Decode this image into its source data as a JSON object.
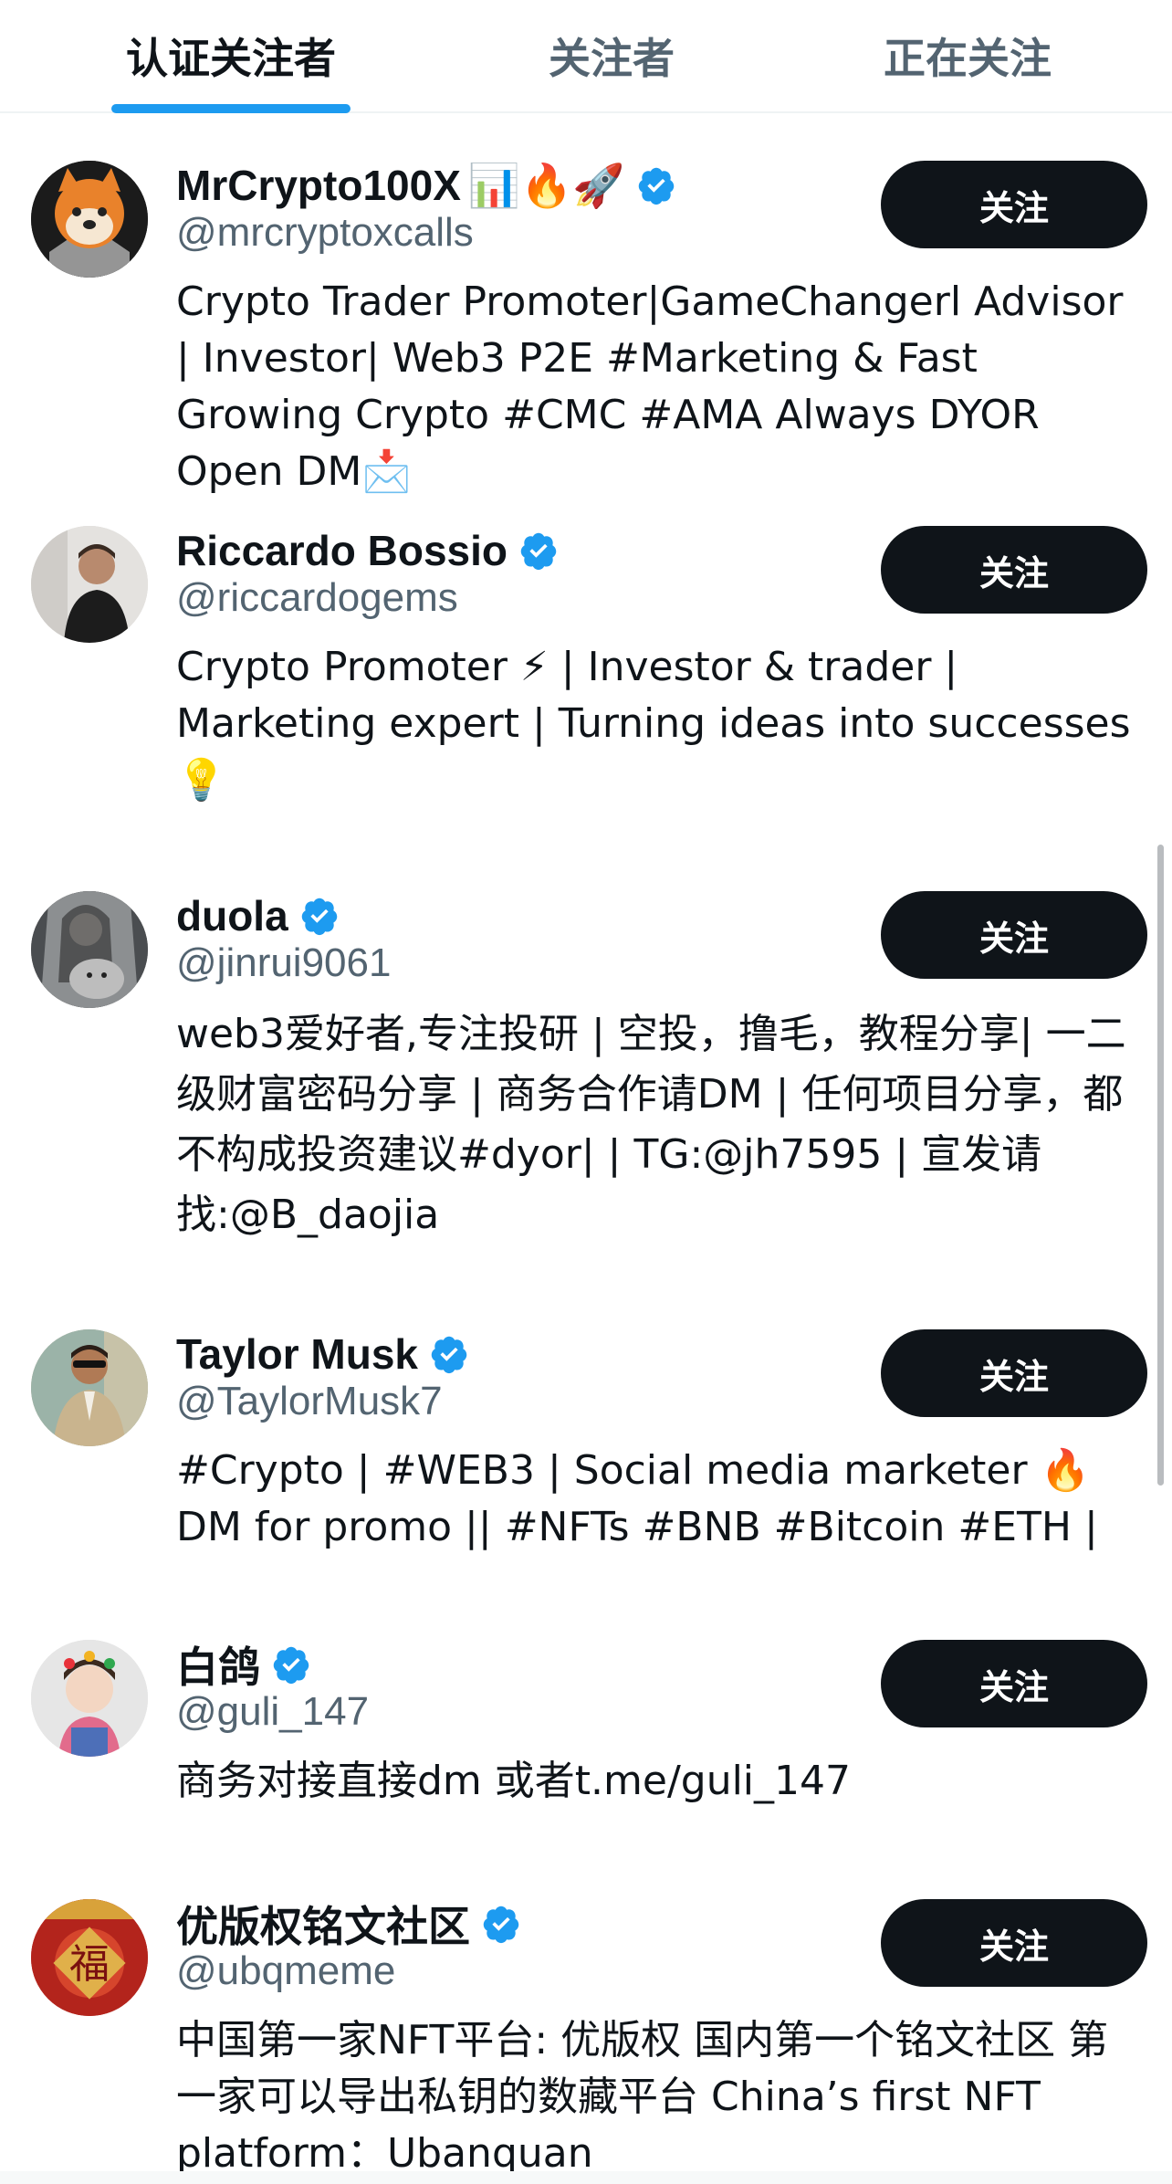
{
  "tabs": [
    {
      "label": "认证关注者",
      "active": true
    },
    {
      "label": "关注者",
      "active": false
    },
    {
      "label": "正在关注",
      "active": false
    }
  ],
  "accent_color": "#1d9bf0",
  "users": [
    {
      "name": "MrCrypto100X",
      "name_emoji": "📊🔥🚀",
      "handle": "@mrcryptoxcalls",
      "bio": "Crypto Trader Promoter|GameChangerl Advisor | Investor| Web3 P2E #Marketing & Fast Growing Crypto #CMC #AMA Always DYOR Open DM📩",
      "button": "关注",
      "avatar_icon": "shiba-avatar"
    },
    {
      "name": "Riccardo Bossio",
      "name_emoji": "",
      "handle": "@riccardogems",
      "bio": "Crypto Promoter ⚡ | Investor & trader | Marketing expert | Turning ideas into successes 💡",
      "button": "关注",
      "avatar_icon": "man-dark-avatar"
    },
    {
      "name": "duola",
      "name_emoji": "",
      "handle": "@jinrui9061",
      "bio": "web3爱好者,专注投研 | 空投，撸毛，教程分享| 一二级财富密码分享 | 商务合作请DM | 任何项目分享，都不构成投资建议#dyor| | TG:@jh7595 | 宣发请找:@B_daojia",
      "button": "关注",
      "avatar_icon": "girl-cat-avatar"
    },
    {
      "name": "Taylor Musk",
      "name_emoji": "",
      "handle": "@TaylorMusk7",
      "bio": "#Crypto | #WEB3 | Social media marketer 🔥 DM for promo || #NFTs #BNB #Bitcoin #ETH |",
      "button": "关注",
      "avatar_icon": "man-suit-avatar"
    },
    {
      "name": "白鸽",
      "name_emoji": "",
      "handle": "@guli_147",
      "bio": "商务对接直接dm 或者t.me/guli_147",
      "button": "关注",
      "avatar_icon": "child-avatar"
    },
    {
      "name": "优版权铭文社区",
      "name_emoji": "",
      "handle": "@ubqmeme",
      "bio": "中国第一家NFT平台: 优版权 国内第一个铭文社区 第一家可以导出私钥的数藏平台 China’s first NFT platform：Ubanquan",
      "button": "关注",
      "avatar_icon": "fu-avatar"
    }
  ]
}
